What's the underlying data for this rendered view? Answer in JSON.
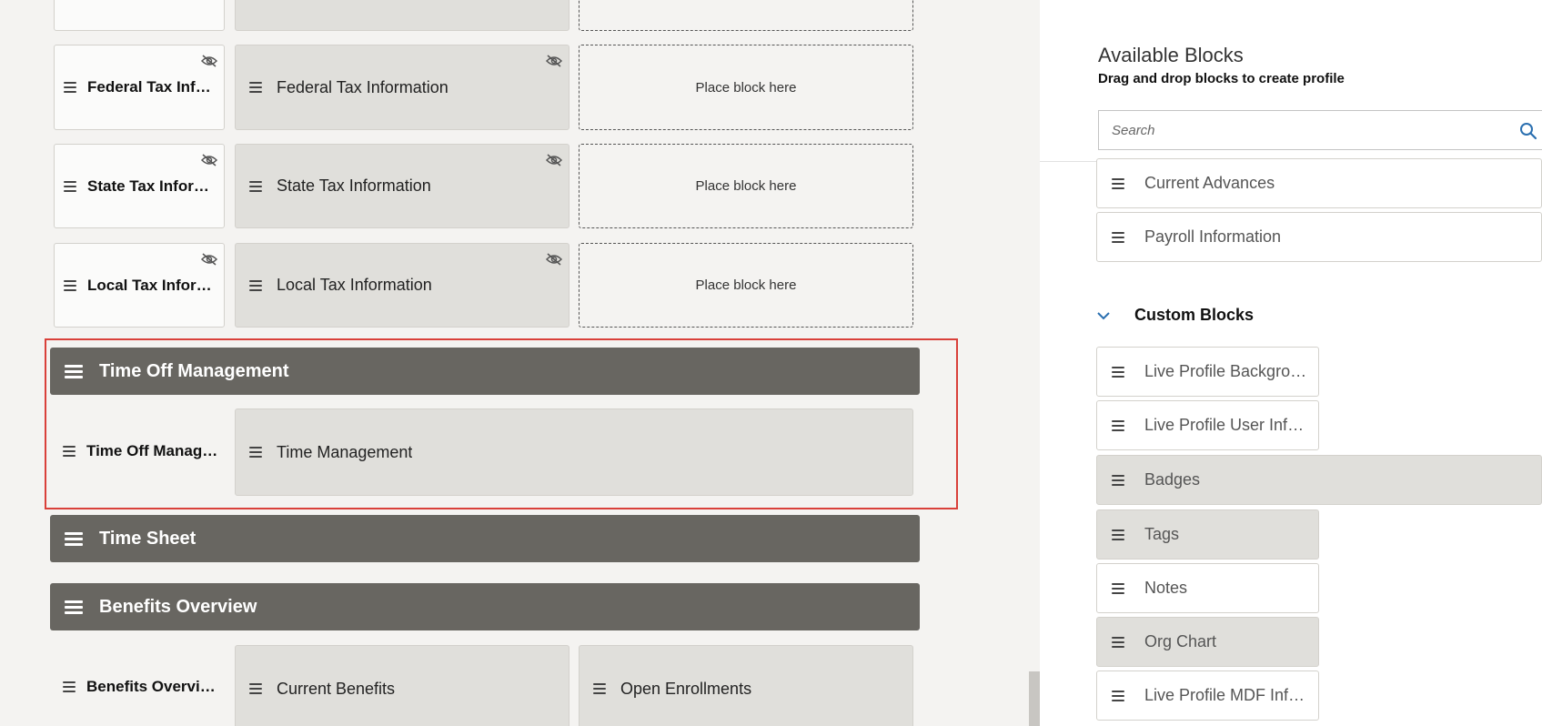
{
  "canvas": {
    "top_row": {},
    "rows": [
      {
        "label": "Federal Tax Inf…",
        "block": "Federal Tax Information",
        "drop": "Place block here"
      },
      {
        "label": "State Tax Infor…",
        "block": "State Tax Information",
        "drop": "Place block here"
      },
      {
        "label": "Local Tax Infor…",
        "block": "Local Tax Information",
        "drop": "Place block here"
      }
    ],
    "sections": {
      "time_off": {
        "title": "Time Off Management",
        "label": "Time Off Manag…",
        "block": "Time Management"
      },
      "time_sheet": {
        "title": "Time Sheet"
      },
      "benefits": {
        "title": "Benefits Overview",
        "label": "Benefits Overvi…",
        "block1": "Current Benefits",
        "block2": "Open Enrollments"
      }
    },
    "highlight_color": "#d9403a",
    "section_color": "#686661"
  },
  "panel": {
    "title": "Available Blocks",
    "subtitle": "Drag and drop blocks to create profile",
    "search": {
      "placeholder": "Search",
      "value": ""
    },
    "standard_blocks": [
      {
        "label": "Current Advances"
      },
      {
        "label": "Payroll Information"
      }
    ],
    "custom": {
      "title": "Custom Blocks",
      "blocks": [
        {
          "label": "Live Profile Backgro…"
        },
        {
          "label": "Live Profile User Info…"
        },
        {
          "label": "Badges"
        },
        {
          "label": "Tags"
        },
        {
          "label": "Notes"
        },
        {
          "label": "Org Chart"
        },
        {
          "label": "Live Profile MDF Inf…"
        }
      ]
    }
  },
  "icons": {
    "drag": "drag-handle-icon",
    "hidden": "eye-slash-icon",
    "search": "search-icon",
    "expand": "chevron-down-icon"
  }
}
